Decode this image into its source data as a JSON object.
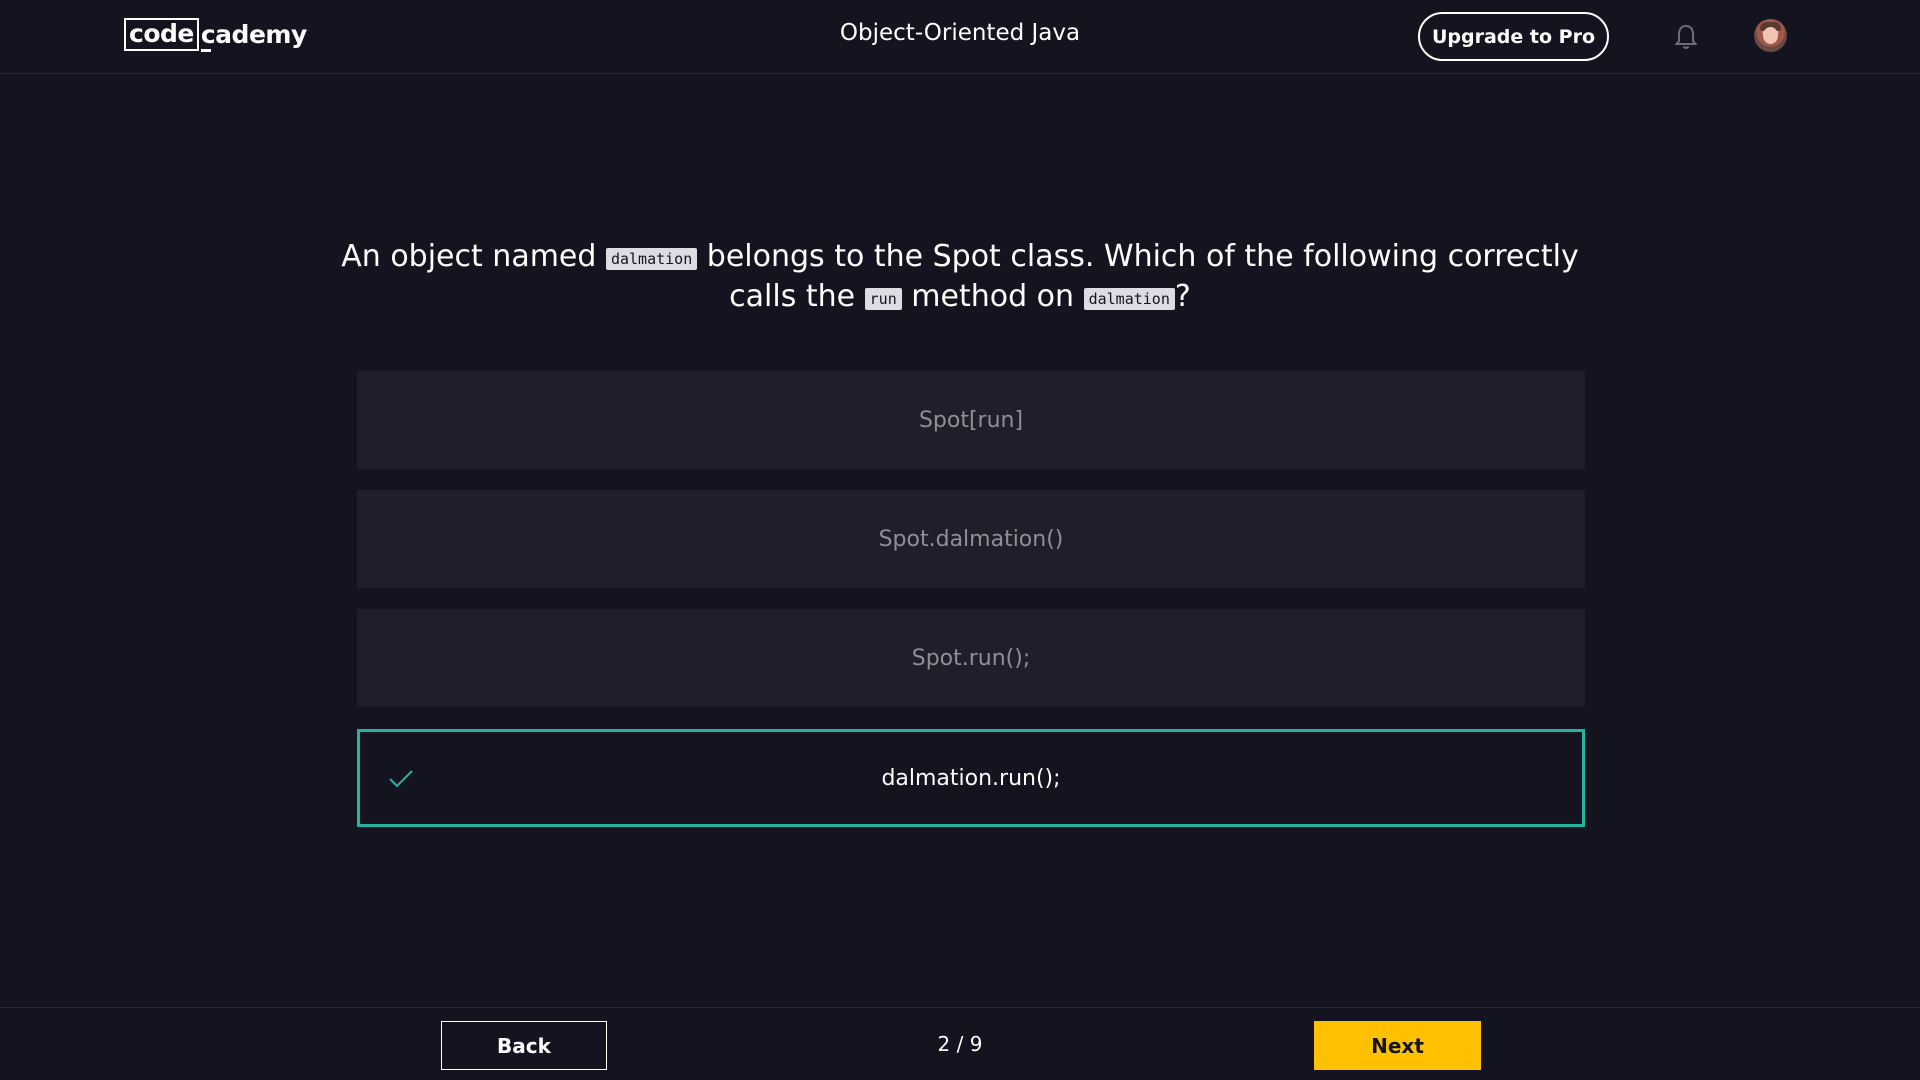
{
  "header": {
    "logo_boxed": "code",
    "logo_rest": "cademy",
    "course_title": "Object-Oriented Java",
    "upgrade_label": "Upgrade to Pro",
    "bell_icon": "bell-icon",
    "avatar_icon": "user-avatar"
  },
  "question": {
    "part1": "An object named ",
    "code1": "dalmation",
    "part2": " belongs to the Spot class. Which of the following correctly calls the ",
    "code2": "run",
    "part3": " method on ",
    "code3": "dalmation",
    "part4": "?"
  },
  "options": [
    {
      "label": "Spot[run]",
      "selected": false
    },
    {
      "label": "Spot.dalmation()",
      "selected": false
    },
    {
      "label": "Spot.run();",
      "selected": false
    },
    {
      "label": "dalmation.run();",
      "selected": true,
      "status": "correct"
    }
  ],
  "colors": {
    "background": "#141420",
    "option_bg": "#1f1f2b",
    "correct_border": "#21b5a1",
    "next_button": "#ffc000"
  },
  "footer": {
    "back_label": "Back",
    "progress": "2 / 9",
    "next_label": "Next"
  }
}
